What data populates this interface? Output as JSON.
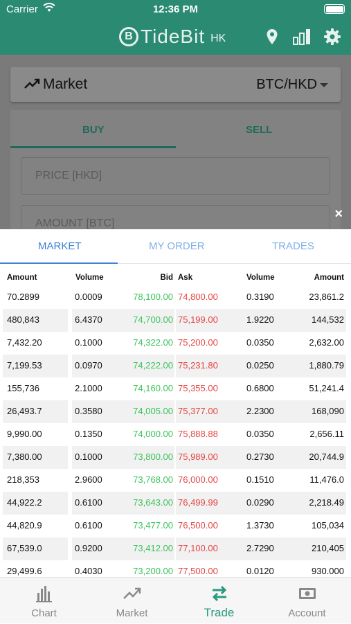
{
  "status": {
    "carrier": "Carrier",
    "time": "12:36 PM"
  },
  "header": {
    "brand": "TideBit",
    "region": "HK",
    "logo_letter": "B"
  },
  "colors": {
    "brand": "#2a8a72",
    "bid": "#3ac45a",
    "ask": "#e64545",
    "tab_active": "#3d84d6"
  },
  "icons": [
    "wifi-icon",
    "battery-icon",
    "location-pin-icon",
    "bar-chart-icon",
    "gear-icon",
    "trend-up-icon",
    "close-icon",
    "chart-icon",
    "market-icon",
    "trade-arrows-icon",
    "account-cash-icon"
  ],
  "market": {
    "label": "Market",
    "pair": "BTC/HKD"
  },
  "order_form": {
    "buy": "BUY",
    "sell": "SELL",
    "price_placeholder": "PRICE [HKD]",
    "amount_placeholder": "AMOUNT [BTC]"
  },
  "sheet": {
    "close": "×",
    "tabs": [
      "MARKET",
      "MY ORDER",
      "TRADES"
    ],
    "headers": [
      "Amount",
      "Volume",
      "Bid",
      "Ask",
      "Volume",
      "Amount"
    ],
    "rows": [
      [
        "70.2899",
        "0.0009",
        "78,100.00",
        "74,800.00",
        "0.3190",
        "23,861.2"
      ],
      [
        "480,843",
        "6.4370",
        "74,700.00",
        "75,199.00",
        "1.9220",
        "144,532"
      ],
      [
        "7,432.20",
        "0.1000",
        "74,322.00",
        "75,200.00",
        "0.0350",
        "2,632.00"
      ],
      [
        "7,199.53",
        "0.0970",
        "74,222.00",
        "75,231.80",
        "0.0250",
        "1,880.79"
      ],
      [
        "155,736",
        "2.1000",
        "74,160.00",
        "75,355.00",
        "0.6800",
        "51,241.4"
      ],
      [
        "26,493.7",
        "0.3580",
        "74,005.00",
        "75,377.00",
        "2.2300",
        "168,090"
      ],
      [
        "9,990.00",
        "0.1350",
        "74,000.00",
        "75,888.88",
        "0.0350",
        "2,656.11"
      ],
      [
        "7,380.00",
        "0.1000",
        "73,800.00",
        "75,989.00",
        "0.2730",
        "20,744.9"
      ],
      [
        "218,353",
        "2.9600",
        "73,768.00",
        "76,000.00",
        "0.1510",
        "11,476.0"
      ],
      [
        "44,922.2",
        "0.6100",
        "73,643.00",
        "76,499.99",
        "0.0290",
        "2,218.49"
      ],
      [
        "44,820.9",
        "0.6100",
        "73,477.00",
        "76,500.00",
        "1.3730",
        "105,034"
      ],
      [
        "67,539.0",
        "0.9200",
        "73,412.00",
        "77,100.00",
        "2.7290",
        "210,405"
      ],
      [
        "29,499.6",
        "0.4030",
        "73,200.00",
        "77,500.00",
        "0.0120",
        "930.000"
      ]
    ]
  },
  "nav": [
    {
      "label": "Chart",
      "icon": "chart-icon"
    },
    {
      "label": "Market",
      "icon": "market-icon"
    },
    {
      "label": "Trade",
      "icon": "trade-arrows-icon",
      "active": true
    },
    {
      "label": "Account",
      "icon": "account-cash-icon"
    }
  ]
}
